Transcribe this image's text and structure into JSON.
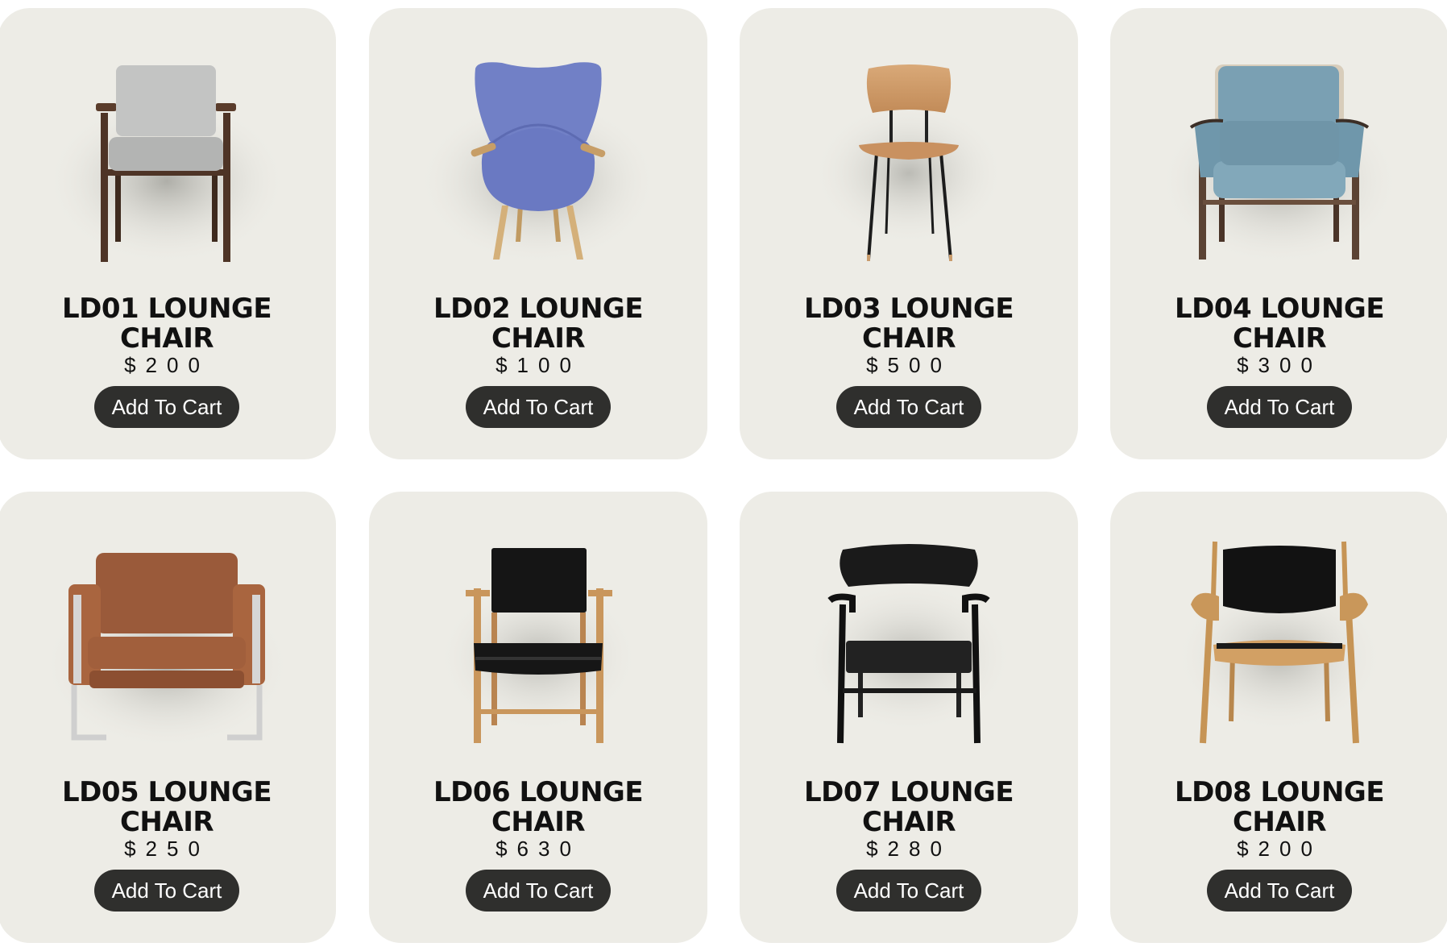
{
  "products": [
    {
      "name_line1": "LD01 LOUNGE",
      "name_line2": "CHAIR",
      "price": "$200",
      "button": "Add To Cart",
      "chair_icon": "armchair-grey-upholstered-icon"
    },
    {
      "name_line1": "LD02 LOUNGE",
      "name_line2": "CHAIR",
      "price": "$100",
      "button": "Add To Cart",
      "chair_icon": "wingback-blue-chair-icon"
    },
    {
      "name_line1": "LD03 LOUNGE",
      "name_line2": "CHAIR",
      "price": "$500",
      "button": "Add To Cart",
      "chair_icon": "wood-seat-metal-leg-chair-icon"
    },
    {
      "name_line1": "LD04 LOUNGE",
      "name_line2": "CHAIR",
      "price": "$300",
      "button": "Add To Cart",
      "chair_icon": "teal-cushion-armchair-icon"
    },
    {
      "name_line1": "LD05 LOUNGE",
      "name_line2": "CHAIR",
      "price": "$250",
      "button": "Add To Cart",
      "chair_icon": "brown-leather-armchair-icon"
    },
    {
      "name_line1": "LD06 LOUNGE",
      "name_line2": "CHAIR",
      "price": "$630",
      "button": "Add To Cart",
      "chair_icon": "oak-black-leather-chair-icon"
    },
    {
      "name_line1": "LD07 LOUNGE",
      "name_line2": "CHAIR",
      "price": "$280",
      "button": "Add To Cart",
      "chair_icon": "black-wood-lounge-chair-icon"
    },
    {
      "name_line1": "LD08 LOUNGE",
      "name_line2": "CHAIR",
      "price": "$200",
      "button": "Add To Cart",
      "chair_icon": "oak-shell-chair-icon"
    }
  ],
  "colors": {
    "card_bg": "#edece6",
    "button_bg": "#2f2f2d",
    "button_text": "#ffffff",
    "text": "#111111"
  }
}
